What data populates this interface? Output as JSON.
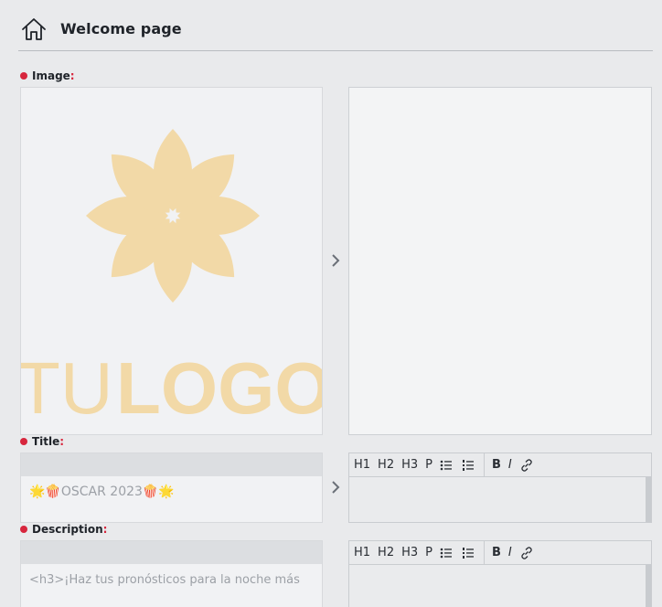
{
  "header": {
    "title": "Welcome page",
    "icon": "home-icon"
  },
  "fields": {
    "image": {
      "label": "Image",
      "colon": ":"
    },
    "title": {
      "label": "Title",
      "colon": ":",
      "value": "🌟🍿OSCAR 2023🍿🌟"
    },
    "description": {
      "label": "Description",
      "colon": ":",
      "value": "<h3>¡Haz tus pronósticos para la noche más"
    }
  },
  "logo": {
    "text_light": "TU",
    "text_bold": "LOGO",
    "color": "#f2d9a7"
  },
  "toolbar": {
    "h1": "H1",
    "h2": "H2",
    "h3": "H3",
    "p": "P",
    "bold": "B",
    "italic": "I"
  },
  "colors": {
    "required_dot": "#d7263d",
    "background": "#e9eaec"
  }
}
